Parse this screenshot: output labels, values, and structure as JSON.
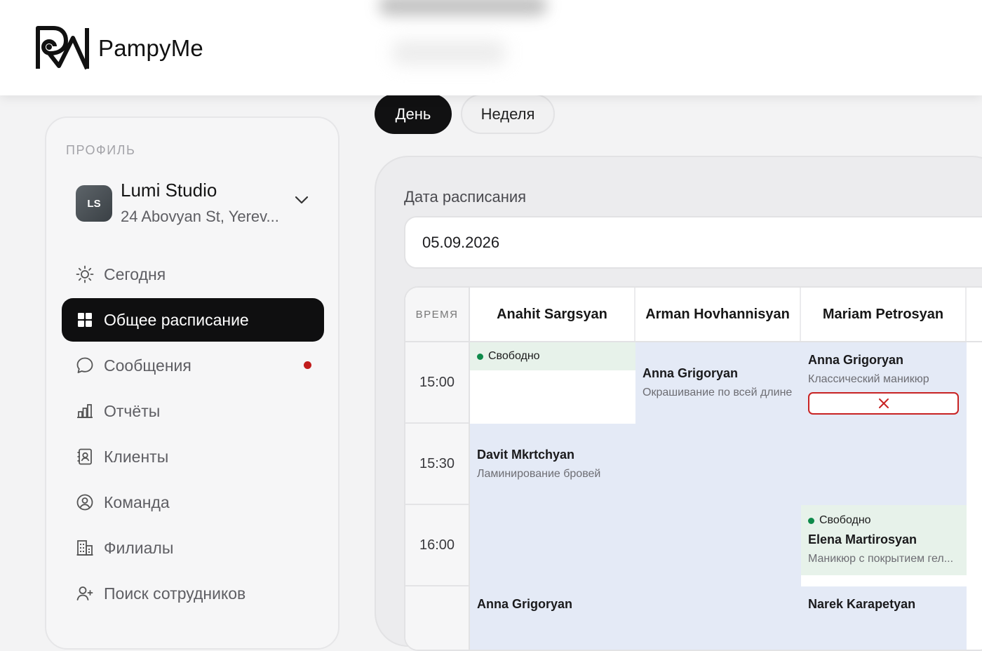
{
  "brand": {
    "name": "PampyMe"
  },
  "sidebar": {
    "section_label": "ПРОФИЛЬ",
    "profile": {
      "initials": "LS",
      "name": "Lumi Studio",
      "address": "24 Abovyan St, Yerev..."
    },
    "nav": [
      {
        "label": "Сегодня",
        "icon": "sun-icon",
        "active": false
      },
      {
        "label": "Общее расписание",
        "icon": "grid-icon",
        "active": true
      },
      {
        "label": "Сообщения",
        "icon": "chat-icon",
        "active": false,
        "has_unread_dot": true
      },
      {
        "label": "Отчёты",
        "icon": "bar-chart-icon",
        "active": false
      },
      {
        "label": "Клиенты",
        "icon": "contacts-icon",
        "active": false
      },
      {
        "label": "Команда",
        "icon": "user-circle-icon",
        "active": false
      },
      {
        "label": "Филиалы",
        "icon": "building-icon",
        "active": false
      },
      {
        "label": "Поиск сотрудников",
        "icon": "add-user-icon",
        "active": false
      }
    ]
  },
  "view_tabs": {
    "day": "День",
    "week": "Неделя",
    "selected": "day"
  },
  "schedule": {
    "date_label": "Дата расписания",
    "date_value": "05.09.2026",
    "time_header": "ВРЕМЯ",
    "staff": [
      "Anahit Sargsyan",
      "Arman Hovhannisyan",
      "Mariam Petrosyan"
    ],
    "times": [
      "15:00",
      "15:30",
      "16:00",
      ""
    ],
    "free_label": "Свободно",
    "appointments": {
      "r1c2": {
        "client": "Anna Grigoryan",
        "service": "Окрашивание по всей длине"
      },
      "r1c3": {
        "client": "Anna Grigoryan",
        "service": "Классический маникюр"
      },
      "r2c1": {
        "client": "Davit Mkrtchyan",
        "service": "Ламинирование бровей"
      },
      "r3c3": {
        "client": "Elena Martirosyan",
        "service": "Маникюр с покрытием гел..."
      },
      "r4c1": {
        "client": "Anna Grigoryan",
        "service": ""
      },
      "r4c3": {
        "client": "Narek Karapetyan",
        "service": ""
      }
    }
  },
  "colors": {
    "accent_dark": "#0f0f10",
    "free_green": "#0e8a4a",
    "unread_red": "#c11c1c",
    "cancel_red": "#c82323",
    "booked_blue": "#e4eaf6"
  }
}
